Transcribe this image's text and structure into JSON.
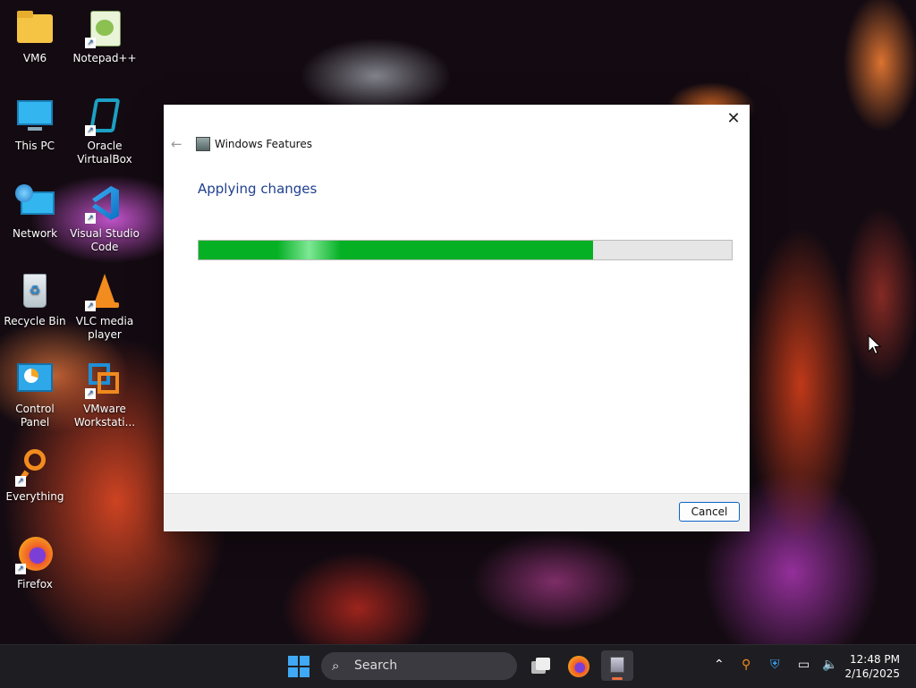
{
  "desktop": {
    "icons": [
      {
        "label": "VM6"
      },
      {
        "label": "Notepad++"
      },
      {
        "label": "This PC"
      },
      {
        "label": "Oracle VirtualBox"
      },
      {
        "label": "Network"
      },
      {
        "label": "Visual Studio Code"
      },
      {
        "label": "Recycle Bin"
      },
      {
        "label": "VLC media player"
      },
      {
        "label": "Control Panel"
      },
      {
        "label": "VMware Workstati..."
      },
      {
        "label": "Everything"
      },
      {
        "label": "Firefox"
      }
    ]
  },
  "dialog": {
    "title": "Windows Features",
    "heading": "Applying changes",
    "progress": 0.74,
    "cancel_label": "Cancel",
    "close_glyph": "✕",
    "back_glyph": "←"
  },
  "taskbar": {
    "search_placeholder": "Search",
    "time": "12:48 PM",
    "date": "2/16/2025"
  },
  "colors": {
    "progress_green": "#06b025",
    "accent_blue": "#0a64c8",
    "heading_blue": "#1f3f8f"
  }
}
